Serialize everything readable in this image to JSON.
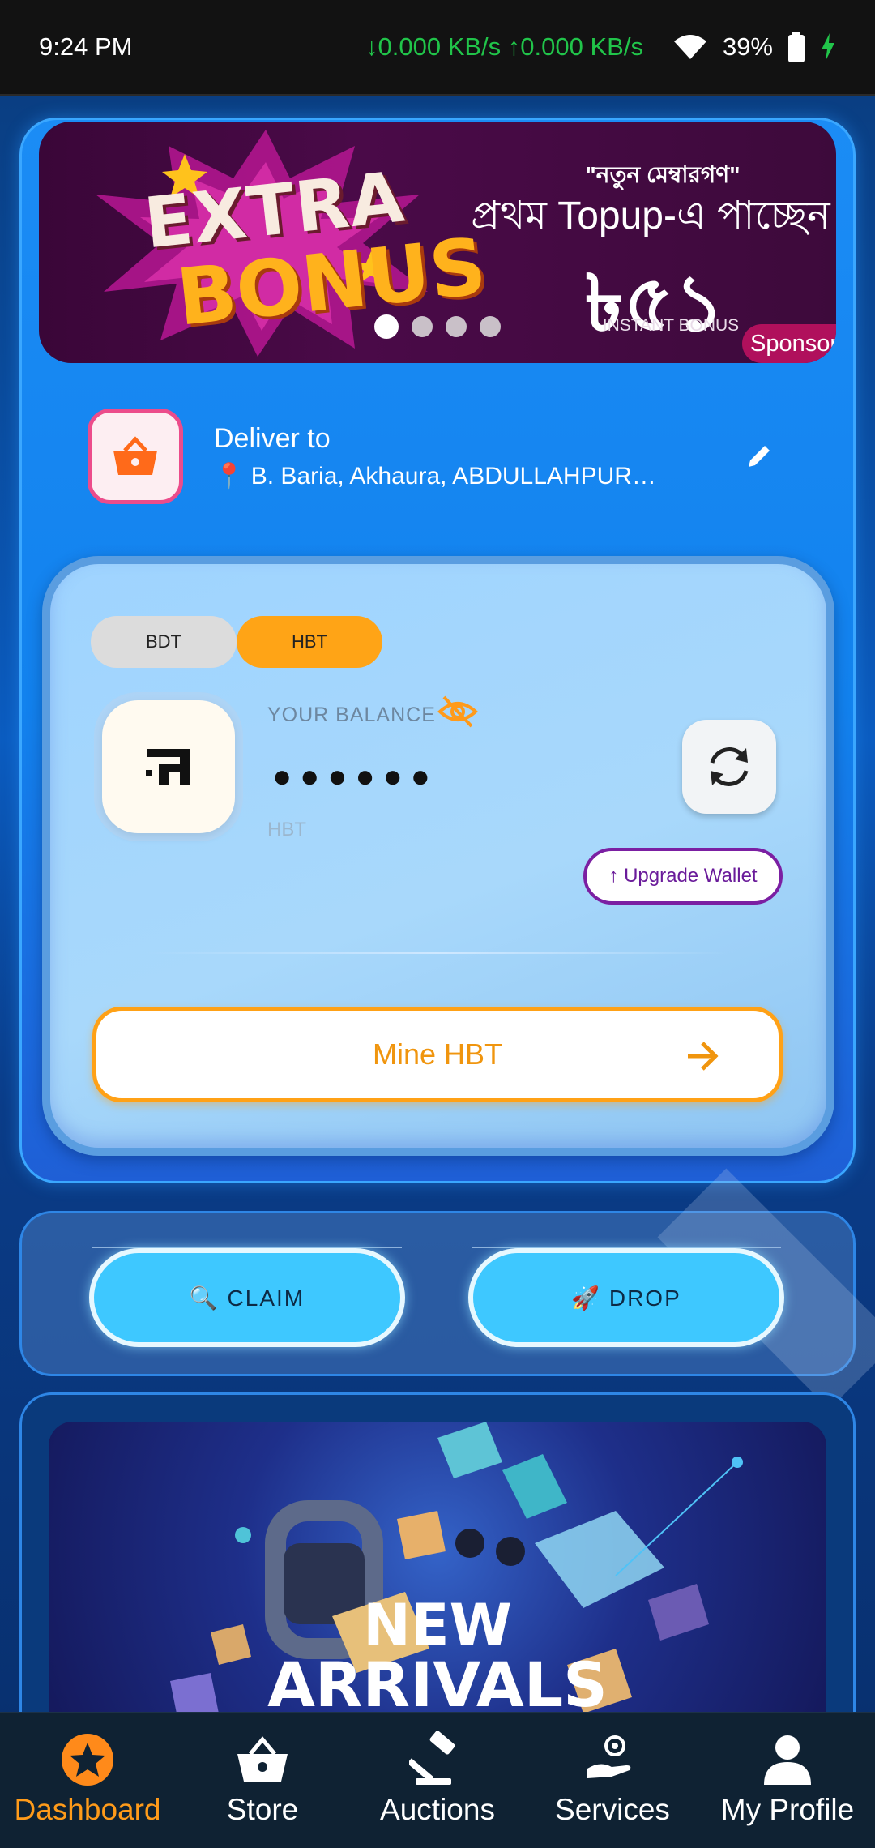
{
  "status_bar": {
    "time": "9:24 PM",
    "network": "↓0.000 KB/s ↑0.000 KB/s",
    "battery": "39%"
  },
  "banner": {
    "extra": "EXTRA",
    "bonus": "BONUS",
    "quote": "\"নতুন মেম্বারগণ\"",
    "headline": "প্রথম Topup-এ পাচ্ছেন",
    "amount": "৳৫১",
    "subtitle": "INSTANT BONUS",
    "sponsored": "Sponsored",
    "slide_count": 4,
    "active_slide": 1
  },
  "delivery": {
    "title": "Deliver to",
    "address": "📍 B. Baria, Akhaura, ABDULLAHPUR…"
  },
  "wallet": {
    "currency_tabs": [
      "BDT",
      "HBT"
    ],
    "selected_currency": "HBT",
    "balance_label": "YOUR BALANCE",
    "balance_value": "●●●●●●",
    "balance_unit": "HBT",
    "upgrade_label": "↑ Upgrade Wallet",
    "mine_label": "Mine HBT"
  },
  "actions": {
    "claim": "🔍 CLAIM",
    "drop": "🚀 DROP"
  },
  "arrivals": {
    "line1": "NEW",
    "line2": "ARRIVALS"
  },
  "nav": {
    "items": [
      {
        "label": "Dashboard",
        "icon": "star-icon",
        "active": true
      },
      {
        "label": "Store",
        "icon": "basket-icon",
        "active": false
      },
      {
        "label": "Auctions",
        "icon": "gavel-icon",
        "active": false
      },
      {
        "label": "Services",
        "icon": "services-icon",
        "active": false
      },
      {
        "label": "My Profile",
        "icon": "profile-icon",
        "active": false
      }
    ]
  },
  "colors": {
    "accent_orange": "#ffa416",
    "panel_blue": "#1b8cf5",
    "pill_cyan": "#3ec8ff",
    "upgrade_purple": "#7b1fa2",
    "nav_bg": "#0f2233"
  }
}
